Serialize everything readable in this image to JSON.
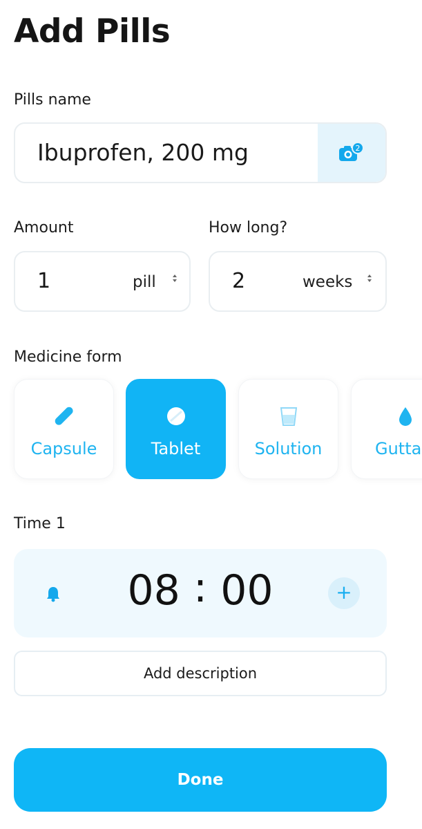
{
  "header": {
    "title": "Add Pills"
  },
  "pill_name": {
    "label": "Pills name",
    "value": "Ibuprofen, 200 mg",
    "camera_badge": "2",
    "camera_icon": "camera-icon"
  },
  "amount": {
    "label": "Amount",
    "value": "1",
    "unit": "pill"
  },
  "how_long": {
    "label": "How long?",
    "value": "2",
    "unit": "weeks"
  },
  "medicine_form": {
    "label": "Medicine form",
    "selected": "Tablet",
    "accent_color": "#11b4f5",
    "options": [
      {
        "label": "Capsule",
        "icon": "capsule-icon"
      },
      {
        "label": "Tablet",
        "icon": "tablet-icon"
      },
      {
        "label": "Solution",
        "icon": "glass-icon"
      },
      {
        "label": "Gutta",
        "icon": "drop-icon"
      }
    ]
  },
  "time": {
    "label": "Time 1",
    "hours": "08",
    "separator": ":",
    "minutes": "00",
    "bell_icon": "bell-icon",
    "add_label": "+"
  },
  "description_button": "Add description",
  "done_button": "Done"
}
